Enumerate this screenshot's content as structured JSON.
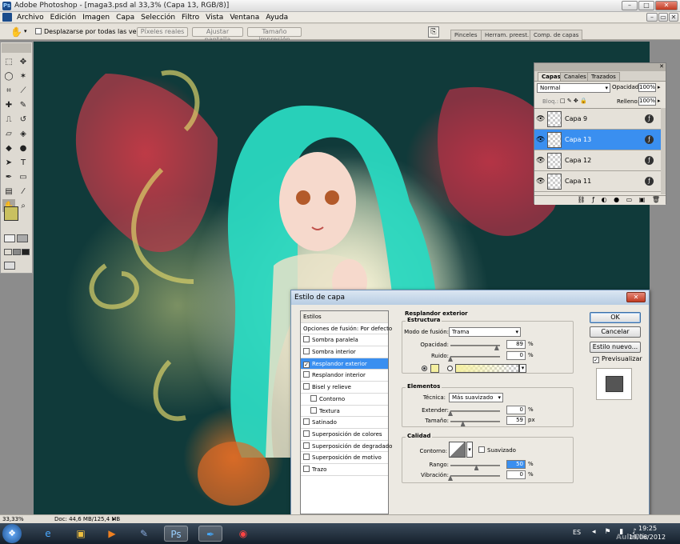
{
  "window": {
    "title": "Adobe Photoshop - [maga3.psd al 33,3% (Capa 13, RGB/8)]"
  },
  "menubar": [
    "Archivo",
    "Edición",
    "Imagen",
    "Capa",
    "Selección",
    "Filtro",
    "Vista",
    "Ventana",
    "Ayuda"
  ],
  "options": {
    "scroll_all_label": "Desplazarse por todas las ventanas",
    "actual_pixels": "Píxeles reales",
    "fit_screen": "Ajustar pantalla",
    "print_size": "Tamaño impresión",
    "palette_tabs": [
      "Pinceles",
      "Herram. preest.",
      "Comp. de capas"
    ]
  },
  "layers_panel": {
    "tabs": [
      "Capas",
      "Canales",
      "Trazados"
    ],
    "blend_mode": "Normal",
    "opacity_label": "Opacidad:",
    "opacity_value": "100%",
    "lock_label": "Bloq.:",
    "fill_label": "Relleno:",
    "fill_value": "100%",
    "layers": [
      {
        "name": "Capa 9",
        "selected": false
      },
      {
        "name": "Capa 13",
        "selected": true
      },
      {
        "name": "Capa 12",
        "selected": false
      },
      {
        "name": "Capa 11",
        "selected": false
      }
    ]
  },
  "dialog": {
    "title": "Estilo de capa",
    "styles_header": "Estilos",
    "styles": [
      {
        "label": "Opciones de fusión: Por defecto",
        "checkbox": false,
        "checked": false,
        "selected": false,
        "indent": 0
      },
      {
        "label": "Sombra paralela",
        "checkbox": true,
        "checked": false,
        "selected": false,
        "indent": 0
      },
      {
        "label": "Sombra interior",
        "checkbox": true,
        "checked": false,
        "selected": false,
        "indent": 0
      },
      {
        "label": "Resplandor exterior",
        "checkbox": true,
        "checked": true,
        "selected": true,
        "indent": 0
      },
      {
        "label": "Resplandor interior",
        "checkbox": true,
        "checked": false,
        "selected": false,
        "indent": 0
      },
      {
        "label": "Bisel y relieve",
        "checkbox": true,
        "checked": false,
        "selected": false,
        "indent": 0
      },
      {
        "label": "Contorno",
        "checkbox": true,
        "checked": false,
        "selected": false,
        "indent": 1
      },
      {
        "label": "Textura",
        "checkbox": true,
        "checked": false,
        "selected": false,
        "indent": 1
      },
      {
        "label": "Satinado",
        "checkbox": true,
        "checked": false,
        "selected": false,
        "indent": 0
      },
      {
        "label": "Superposición de colores",
        "checkbox": true,
        "checked": false,
        "selected": false,
        "indent": 0
      },
      {
        "label": "Superposición de degradado",
        "checkbox": true,
        "checked": false,
        "selected": false,
        "indent": 0
      },
      {
        "label": "Superposición de motivo",
        "checkbox": true,
        "checked": false,
        "selected": false,
        "indent": 0
      },
      {
        "label": "Trazo",
        "checkbox": true,
        "checked": false,
        "selected": false,
        "indent": 0
      }
    ],
    "section_title": "Resplandor exterior",
    "structure": {
      "title": "Estructura",
      "blend_label": "Modo de fusión:",
      "blend_value": "Trama",
      "opacity_label": "Opacidad:",
      "opacity_value": "89",
      "opacity_fraction": 0.89,
      "noise_label": "Ruido:",
      "noise_value": "0",
      "noise_fraction": 0.0,
      "glow_color": "#f5f0a0"
    },
    "elements": {
      "title": "Elementos",
      "technique_label": "Técnica:",
      "technique_value": "Más suavizado",
      "spread_label": "Extender:",
      "spread_value": "0",
      "spread_fraction": 0.0,
      "size_label": "Tamaño:",
      "size_value": "59",
      "size_fraction": 0.24
    },
    "quality": {
      "title": "Calidad",
      "contour_label": "Contorno:",
      "antialias_label": "Suavizado",
      "range_label": "Rango:",
      "range_value": "50",
      "range_fraction": 0.5,
      "jitter_label": "Vibración:",
      "jitter_value": "0",
      "jitter_fraction": 0.0
    },
    "units": {
      "percent": "%",
      "px": "px"
    },
    "buttons": {
      "ok": "OK",
      "cancel": "Cancelar",
      "new_style": "Estilo nuevo...",
      "preview": "Previsualizar"
    }
  },
  "statusbar": {
    "zoom": "33,33%",
    "doc": "Doc: 44,6 MB/125,4 MB"
  },
  "taskbar": {
    "lang": "ES",
    "time": "19:25",
    "date": "19/06/2012"
  },
  "canvas_text": {
    "watermark": "AulaClic"
  },
  "colors": {
    "foreground": "#c9c060",
    "background": "#68e0d6",
    "selection": "#3a8ff0",
    "hair": "#2ad8c0"
  }
}
